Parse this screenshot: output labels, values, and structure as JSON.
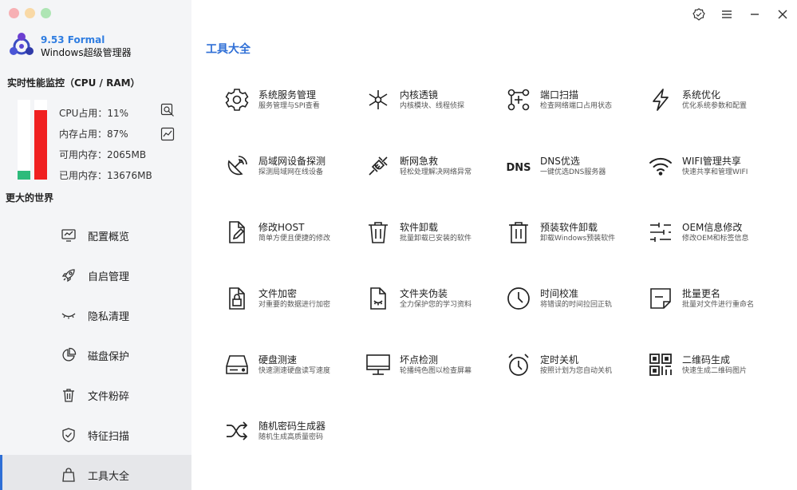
{
  "app": {
    "version": "9.53 Formal",
    "name": "Windows超级管理器"
  },
  "colors": {
    "accent": "#2f6fd6",
    "cpu_bar": "#2dbb7b",
    "mem_bar": "#f02020"
  },
  "perf": {
    "title": "实时性能监控（CPU / RAM）",
    "cpu_usage": 0.11,
    "mem_usage": 0.87,
    "cpu_text": "CPU占用：11%",
    "mem_text": "内存占用：87%",
    "avail_text": "可用内存：2065MB",
    "used_text": "已用内存：13676MB"
  },
  "sidebar": {
    "slogan": "更大的世界",
    "items": [
      {
        "label": "配置概览",
        "icon": "monitor-chart-icon"
      },
      {
        "label": "自启管理",
        "icon": "rocket-icon"
      },
      {
        "label": "隐私清理",
        "icon": "closed-eye-icon"
      },
      {
        "label": "磁盘保护",
        "icon": "pie-chart-icon"
      },
      {
        "label": "文件粉碎",
        "icon": "trash-icon"
      },
      {
        "label": "特征扫描",
        "icon": "shield-check-icon"
      },
      {
        "label": "工具大全",
        "icon": "bag-icon",
        "active": true
      }
    ]
  },
  "main": {
    "title": "工具大全",
    "tools": [
      {
        "title": "系统服务管理",
        "desc": "服务管理与SPI查看",
        "icon": "gear-icon"
      },
      {
        "title": "内核透镜",
        "desc": "内核模块、线程侦探",
        "icon": "molecule-icon"
      },
      {
        "title": "端口扫描",
        "desc": "检查网络端口占用状态",
        "icon": "port-scan-icon"
      },
      {
        "title": "系统优化",
        "desc": "优化系统参数和配置",
        "icon": "lightning-icon"
      },
      {
        "title": "局域网设备探测",
        "desc": "探测局域网在线设备",
        "icon": "satellite-dish-icon"
      },
      {
        "title": "断网急救",
        "desc": "轻松处理解决网络异常",
        "icon": "plug-icon"
      },
      {
        "title": "DNS优选",
        "desc": "一键优选DNS服务器",
        "icon": "dns-icon",
        "icon_text": "DNS"
      },
      {
        "title": "WIFI管理共享",
        "desc": "快速共享和管理WIFI",
        "icon": "wifi-icon"
      },
      {
        "title": "修改HOST",
        "desc": "简单方便且便捷的修改",
        "icon": "file-edit-icon"
      },
      {
        "title": "软件卸载",
        "desc": "批量卸载已安装的软件",
        "icon": "trash-icon"
      },
      {
        "title": "预装软件卸载",
        "desc": "卸载Windows预装软件",
        "icon": "trash-box-icon"
      },
      {
        "title": "OEM信息修改",
        "desc": "修改OEM和标签信息",
        "icon": "sliders-icon"
      },
      {
        "title": "文件加密",
        "desc": "对重要的数据进行加密",
        "icon": "file-lock-icon"
      },
      {
        "title": "文件夹伪装",
        "desc": "全力保护您的学习资料",
        "icon": "file-eye-icon"
      },
      {
        "title": "时间校准",
        "desc": "将错误的时间拉回正轨",
        "icon": "clock-icon"
      },
      {
        "title": "批量更名",
        "desc": "批量对文件进行重命名",
        "icon": "rename-icon"
      },
      {
        "title": "硬盘测速",
        "desc": "快速测速硬盘读写速度",
        "icon": "hard-drive-icon"
      },
      {
        "title": "坏点检测",
        "desc": "轮播纯色图以检查屏幕",
        "icon": "monitor-icon"
      },
      {
        "title": "定时关机",
        "desc": "按照计划为您自动关机",
        "icon": "alarm-clock-icon"
      },
      {
        "title": "二维码生成",
        "desc": "快速生成二维码图片",
        "icon": "qr-code-icon"
      },
      {
        "title": "随机密码生成器",
        "desc": "随机生成高质量密码",
        "icon": "shuffle-icon"
      }
    ]
  },
  "window_controls": [
    "verified-icon",
    "menu-icon",
    "minimize-icon",
    "close-icon"
  ]
}
